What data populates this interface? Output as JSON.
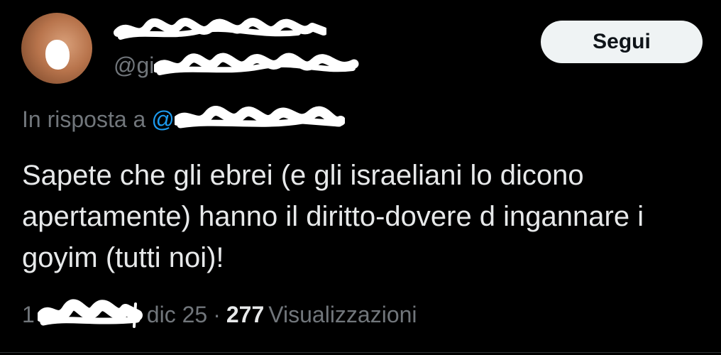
{
  "header": {
    "handle_prefix": "@gi"
  },
  "follow_button": {
    "label": "Segui"
  },
  "reply": {
    "prefix": "In risposta a",
    "at_symbol": "@"
  },
  "tweet": {
    "text": "Sapete che gli ebrei (e gli israeliani lo dicono apertamente) hanno il diritto-dovere d ingannare i goyim (tutti noi)!"
  },
  "meta": {
    "date_prefix": "1",
    "date_suffix": "dic 25",
    "separator": "·",
    "views_count": "277",
    "views_label": "Visualizzazioni"
  },
  "colors": {
    "background": "#000000",
    "text_primary": "#e7e9ea",
    "text_secondary": "#71767b",
    "link": "#1d9bf0",
    "button_bg": "#eff3f4",
    "button_text": "#0f1419"
  },
  "icons": {
    "avatar": "profile-avatar",
    "redaction": "white-scribble-redaction"
  }
}
